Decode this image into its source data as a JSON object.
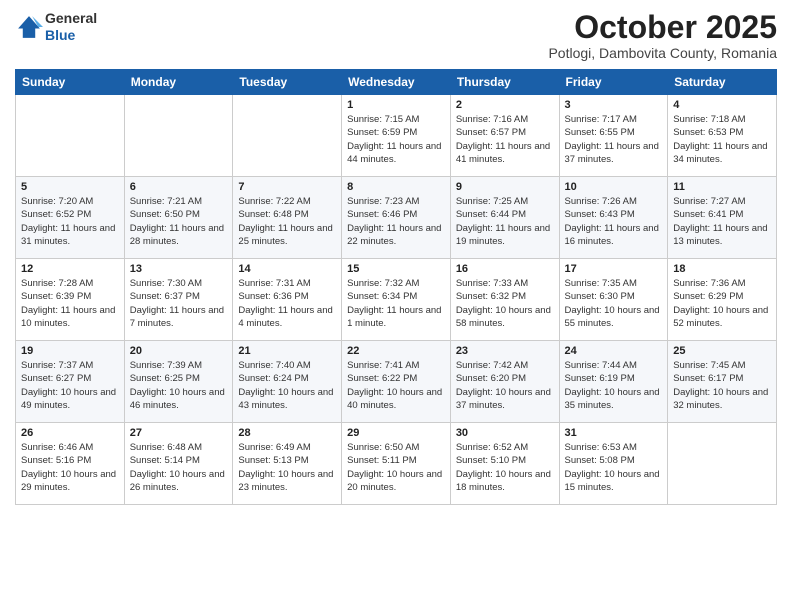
{
  "header": {
    "logo_general": "General",
    "logo_blue": "Blue",
    "month_title": "October 2025",
    "location": "Potlogi, Dambovita County, Romania"
  },
  "weekdays": [
    "Sunday",
    "Monday",
    "Tuesday",
    "Wednesday",
    "Thursday",
    "Friday",
    "Saturday"
  ],
  "weeks": [
    [
      {
        "day": "",
        "info": ""
      },
      {
        "day": "",
        "info": ""
      },
      {
        "day": "",
        "info": ""
      },
      {
        "day": "1",
        "sunrise": "7:15 AM",
        "sunset": "6:59 PM",
        "daylight": "11 hours and 44 minutes."
      },
      {
        "day": "2",
        "sunrise": "7:16 AM",
        "sunset": "6:57 PM",
        "daylight": "11 hours and 41 minutes."
      },
      {
        "day": "3",
        "sunrise": "7:17 AM",
        "sunset": "6:55 PM",
        "daylight": "11 hours and 37 minutes."
      },
      {
        "day": "4",
        "sunrise": "7:18 AM",
        "sunset": "6:53 PM",
        "daylight": "11 hours and 34 minutes."
      }
    ],
    [
      {
        "day": "5",
        "sunrise": "7:20 AM",
        "sunset": "6:52 PM",
        "daylight": "11 hours and 31 minutes."
      },
      {
        "day": "6",
        "sunrise": "7:21 AM",
        "sunset": "6:50 PM",
        "daylight": "11 hours and 28 minutes."
      },
      {
        "day": "7",
        "sunrise": "7:22 AM",
        "sunset": "6:48 PM",
        "daylight": "11 hours and 25 minutes."
      },
      {
        "day": "8",
        "sunrise": "7:23 AM",
        "sunset": "6:46 PM",
        "daylight": "11 hours and 22 minutes."
      },
      {
        "day": "9",
        "sunrise": "7:25 AM",
        "sunset": "6:44 PM",
        "daylight": "11 hours and 19 minutes."
      },
      {
        "day": "10",
        "sunrise": "7:26 AM",
        "sunset": "6:43 PM",
        "daylight": "11 hours and 16 minutes."
      },
      {
        "day": "11",
        "sunrise": "7:27 AM",
        "sunset": "6:41 PM",
        "daylight": "11 hours and 13 minutes."
      }
    ],
    [
      {
        "day": "12",
        "sunrise": "7:28 AM",
        "sunset": "6:39 PM",
        "daylight": "11 hours and 10 minutes."
      },
      {
        "day": "13",
        "sunrise": "7:30 AM",
        "sunset": "6:37 PM",
        "daylight": "11 hours and 7 minutes."
      },
      {
        "day": "14",
        "sunrise": "7:31 AM",
        "sunset": "6:36 PM",
        "daylight": "11 hours and 4 minutes."
      },
      {
        "day": "15",
        "sunrise": "7:32 AM",
        "sunset": "6:34 PM",
        "daylight": "11 hours and 1 minute."
      },
      {
        "day": "16",
        "sunrise": "7:33 AM",
        "sunset": "6:32 PM",
        "daylight": "10 hours and 58 minutes."
      },
      {
        "day": "17",
        "sunrise": "7:35 AM",
        "sunset": "6:30 PM",
        "daylight": "10 hours and 55 minutes."
      },
      {
        "day": "18",
        "sunrise": "7:36 AM",
        "sunset": "6:29 PM",
        "daylight": "10 hours and 52 minutes."
      }
    ],
    [
      {
        "day": "19",
        "sunrise": "7:37 AM",
        "sunset": "6:27 PM",
        "daylight": "10 hours and 49 minutes."
      },
      {
        "day": "20",
        "sunrise": "7:39 AM",
        "sunset": "6:25 PM",
        "daylight": "10 hours and 46 minutes."
      },
      {
        "day": "21",
        "sunrise": "7:40 AM",
        "sunset": "6:24 PM",
        "daylight": "10 hours and 43 minutes."
      },
      {
        "day": "22",
        "sunrise": "7:41 AM",
        "sunset": "6:22 PM",
        "daylight": "10 hours and 40 minutes."
      },
      {
        "day": "23",
        "sunrise": "7:42 AM",
        "sunset": "6:20 PM",
        "daylight": "10 hours and 37 minutes."
      },
      {
        "day": "24",
        "sunrise": "7:44 AM",
        "sunset": "6:19 PM",
        "daylight": "10 hours and 35 minutes."
      },
      {
        "day": "25",
        "sunrise": "7:45 AM",
        "sunset": "6:17 PM",
        "daylight": "10 hours and 32 minutes."
      }
    ],
    [
      {
        "day": "26",
        "sunrise": "6:46 AM",
        "sunset": "5:16 PM",
        "daylight": "10 hours and 29 minutes."
      },
      {
        "day": "27",
        "sunrise": "6:48 AM",
        "sunset": "5:14 PM",
        "daylight": "10 hours and 26 minutes."
      },
      {
        "day": "28",
        "sunrise": "6:49 AM",
        "sunset": "5:13 PM",
        "daylight": "10 hours and 23 minutes."
      },
      {
        "day": "29",
        "sunrise": "6:50 AM",
        "sunset": "5:11 PM",
        "daylight": "10 hours and 20 minutes."
      },
      {
        "day": "30",
        "sunrise": "6:52 AM",
        "sunset": "5:10 PM",
        "daylight": "10 hours and 18 minutes."
      },
      {
        "day": "31",
        "sunrise": "6:53 AM",
        "sunset": "5:08 PM",
        "daylight": "10 hours and 15 minutes."
      },
      {
        "day": "",
        "info": ""
      }
    ]
  ]
}
